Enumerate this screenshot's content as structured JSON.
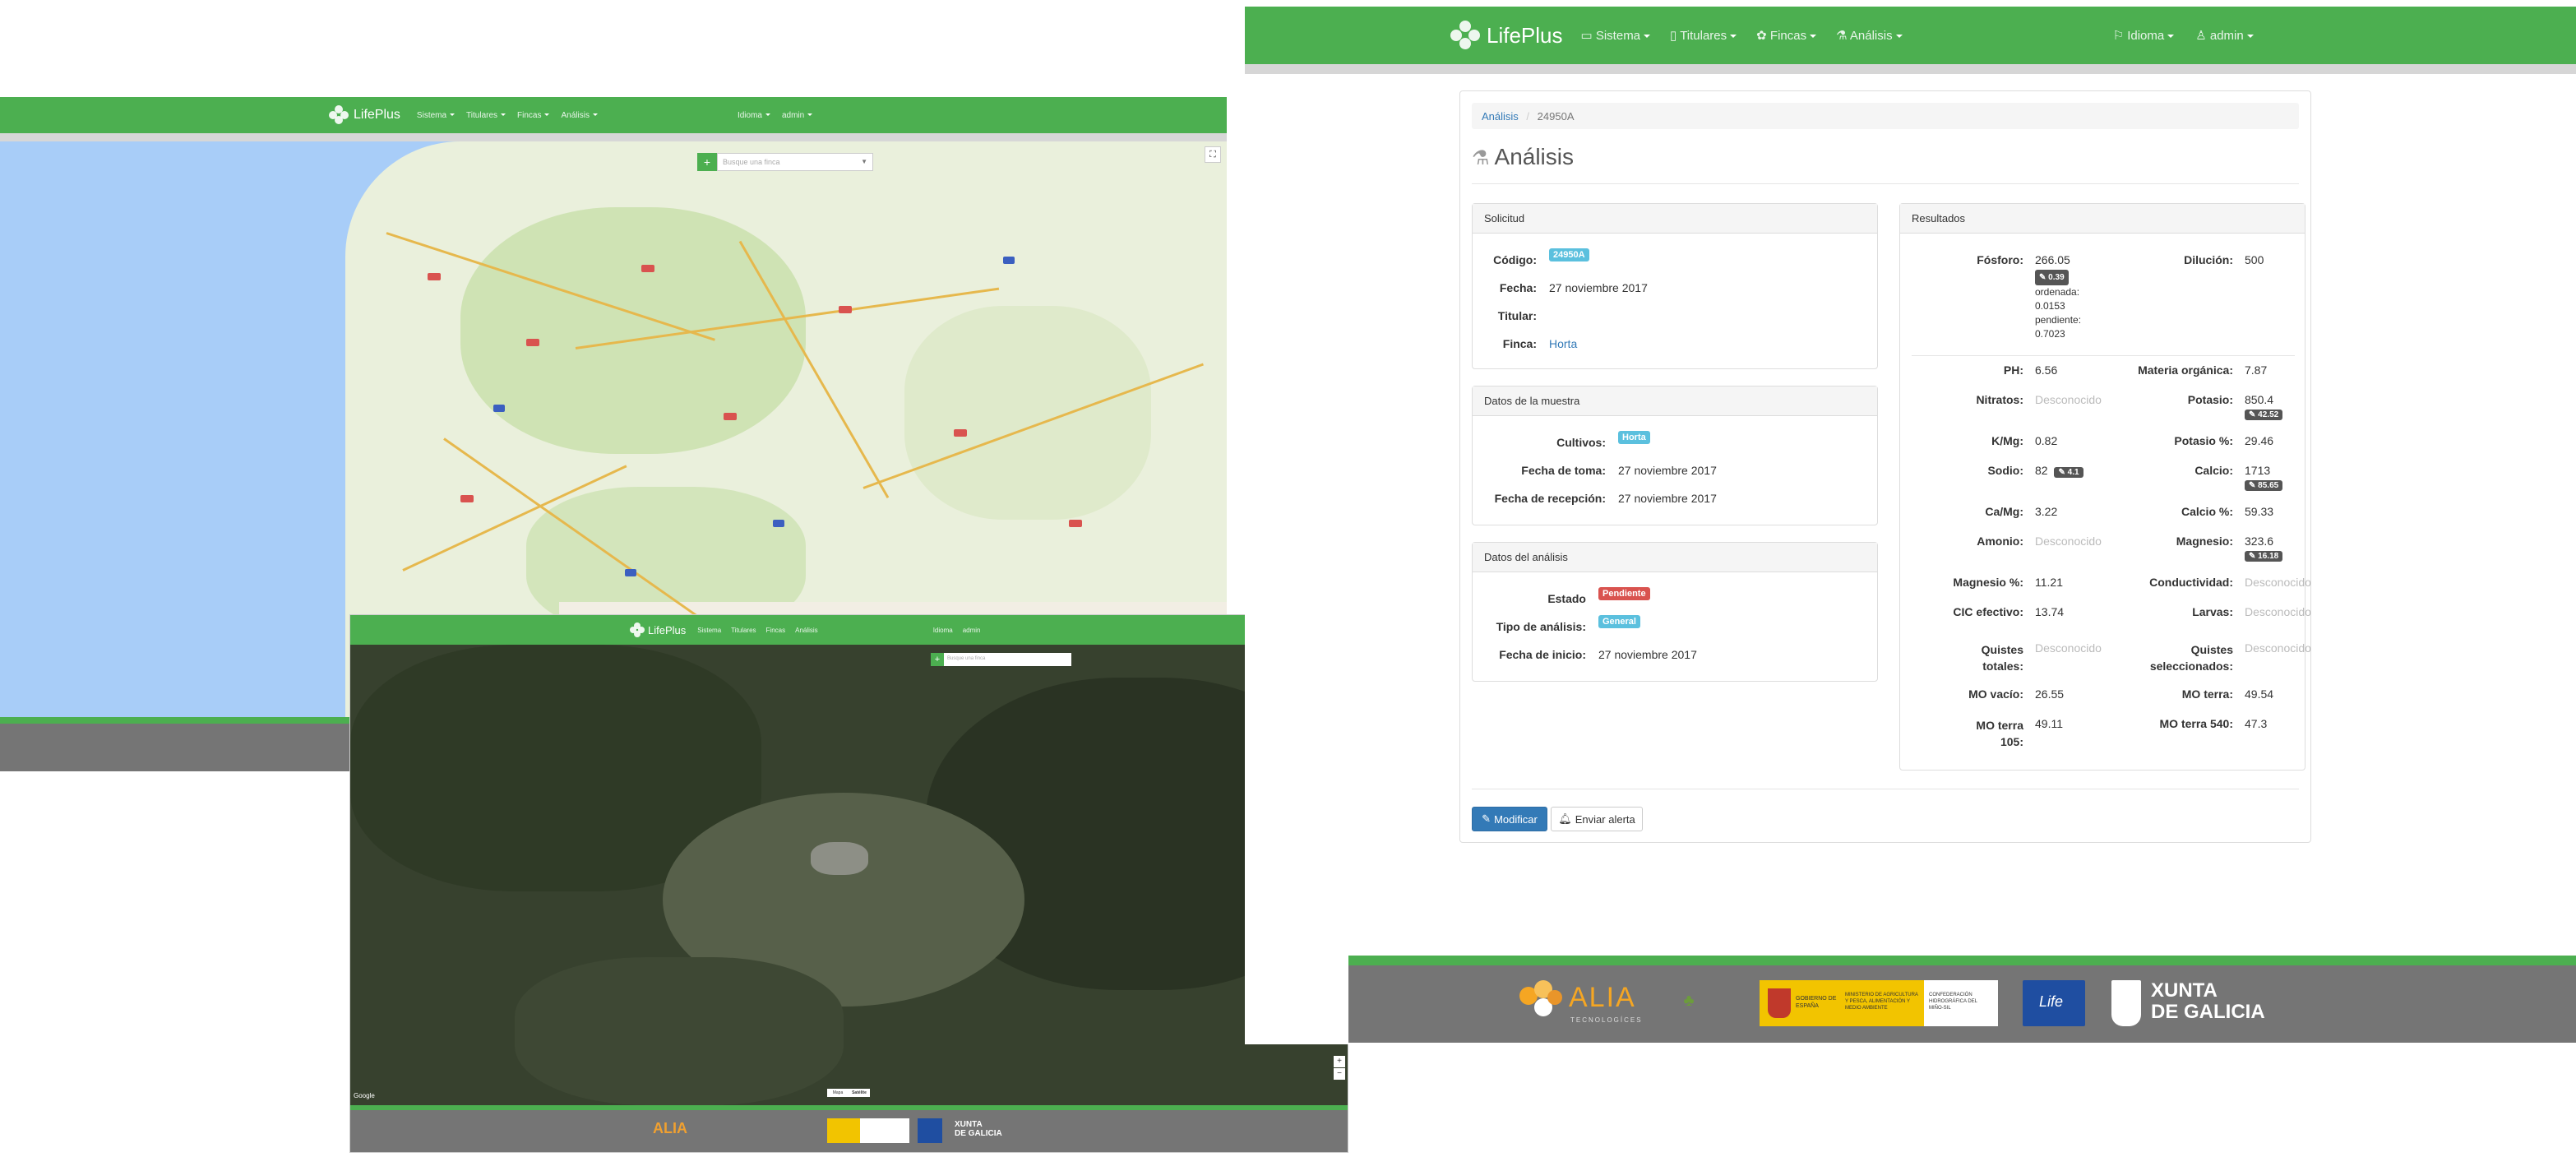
{
  "app": {
    "brand": "LifePlus",
    "menu": {
      "sistema": "Sistema",
      "titulares": "Titulares",
      "fincas": "Fincas",
      "analisis": "Análisis",
      "idioma": "Idioma",
      "admin": "admin"
    }
  },
  "map_window": {
    "search_placeholder": "Busque una finca"
  },
  "satellite_window": {
    "search_placeholder": "Busque una finca",
    "google": "Google",
    "toggle_map": "Mapa",
    "toggle_satellite": "Satélite",
    "zoom_in": "+",
    "zoom_out": "−"
  },
  "breadcrumb": {
    "root": "Análisis",
    "separator": "/",
    "current": "24950A"
  },
  "page_title": "Análisis",
  "solicitud": {
    "title": "Solicitud",
    "codigo_label": "Código:",
    "codigo_badge": "24950A",
    "fecha_label": "Fecha:",
    "fecha": "27 noviembre 2017",
    "titular_label": "Titular:",
    "titular": "",
    "finca_label": "Finca:",
    "finca": "Horta"
  },
  "muestra": {
    "title": "Datos de la muestra",
    "cultivos_label": "Cultivos:",
    "cultivos_badge": "Horta",
    "toma_label": "Fecha de toma:",
    "toma": "27 noviembre 2017",
    "recepcion_label": "Fecha de recepción:",
    "recepcion": "27 noviembre 2017"
  },
  "analisis": {
    "title": "Datos del análisis",
    "estado_label": "Estado",
    "estado_badge": "Pendiente",
    "tipo_label": "Tipo de análisis:",
    "tipo_badge": "General",
    "inicio_label": "Fecha de inicio:",
    "inicio": "27 noviembre 2017"
  },
  "resultados": {
    "title": "Resultados",
    "fosforo_label": "Fósforo:",
    "fosforo": "266.05",
    "fosforo_chip": "0.39",
    "ordenada_label": "ordenada:",
    "ordenada": "0.0153",
    "pendiente_label": "pendiente:",
    "pendiente": "0.7023",
    "dilucion_label": "Dilución:",
    "dilucion": "500",
    "ph_label": "PH:",
    "ph": "6.56",
    "materia_label": "Materia orgánica:",
    "materia": "7.87",
    "nitratos_label": "Nitratos:",
    "nitratos": "Desconocido",
    "potasio_label": "Potasio:",
    "potasio": "850.4",
    "potasio_chip": "42.52",
    "kmg_label": "K/Mg:",
    "kmg": "0.82",
    "potasio_pct_label": "Potasio %:",
    "potasio_pct": "29.46",
    "sodio_label": "Sodio:",
    "sodio": "82",
    "sodio_chip": "4.1",
    "calcio_label": "Calcio:",
    "calcio": "1713",
    "calcio_chip": "85.65",
    "camg_label": "Ca/Mg:",
    "camg": "3.22",
    "calcio_pct_label": "Calcio %:",
    "calcio_pct": "59.33",
    "amonio_label": "Amonio:",
    "amonio": "Desconocido",
    "magnesio_label": "Magnesio:",
    "magnesio": "323.6",
    "magnesio_chip": "16.18",
    "magnesio_pct_label": "Magnesio %:",
    "magnesio_pct": "11.21",
    "conductividad_label": "Conductividad:",
    "conductividad": "Desconocido",
    "cic_label": "CIC efectivo:",
    "cic": "13.74",
    "larvas_label": "Larvas:",
    "larvas": "Desconocido",
    "quistes_tot_label_1": "Quistes",
    "quistes_tot_label_2": "totales:",
    "quistes_tot": "Desconocido",
    "quistes_sel_label_1": "Quistes",
    "quistes_sel_label_2": "seleccionados:",
    "quistes_sel": "Desconocido",
    "mo_vacio_label": "MO vacío:",
    "mo_vacio": "26.55",
    "mo_terra_label": "MO terra:",
    "mo_terra": "49.54",
    "mo_105_label_1": "MO terra",
    "mo_105_label_2": "105:",
    "mo_105": "49.11",
    "mo_540_label": "MO terra 540:",
    "mo_540": "47.3"
  },
  "actions": {
    "modificar": "Modificar",
    "enviar": "Enviar alerta"
  },
  "footer": {
    "alia": "ALIA",
    "alia_sub": "TECNOLOGÍCES",
    "gobierno": "GOBIERNO DE ESPAÑA",
    "ministerio": "MINISTERIO DE AGRICULTURA Y PESCA, ALIMENTACIÓN Y MEDIO AMBIENTE",
    "confederacion": "CONFEDERACIÓN HIDROGRÁFICA DEL MIÑO-SIL",
    "life": "Life",
    "xunta_1": "XUNTA",
    "xunta_2": "DE GALICIA"
  },
  "colors": {
    "green": "#4caf50",
    "footer_gray": "#757575",
    "label_info": "#5bc0de",
    "label_danger": "#d9534f",
    "primary": "#337ab7"
  }
}
